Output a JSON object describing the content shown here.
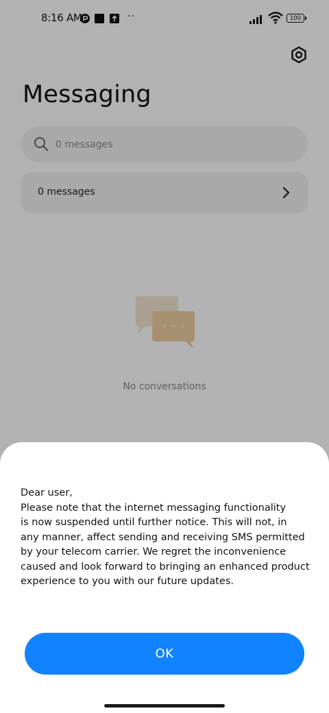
{
  "status_bar": {
    "time": "8:16 AM",
    "icons": [
      "app-notification-icon",
      "square-notification-icon",
      "upload-notification-icon",
      "more-notifications-icon",
      "signal-icon",
      "wifi-icon",
      "battery-icon"
    ],
    "more_dots": "··",
    "battery_level": "100"
  },
  "header": {
    "title": "Messaging",
    "settings_icon": "settings-icon"
  },
  "search": {
    "placeholder": "0 messages",
    "icon": "search-icon"
  },
  "messages_row": {
    "label": "0 messages",
    "icon": "chevron-right-icon"
  },
  "empty_state": {
    "icon": "chat-bubbles-icon",
    "text": "No conversations"
  },
  "dialog": {
    "body": "Dear user,\nPlease note that the internet messaging functionality\nis now suspended until further notice. This will not, in\nany manner, affect sending and receiving SMS permitted\nby your telecom carrier. We regret the inconvenience\ncaused and look forward to bringing an enhanced product\nexperience to you with our future updates.",
    "ok_label": "OK"
  },
  "colors": {
    "accent": "#1183ff",
    "scrim": "rgba(0,0,0,0.30)",
    "bubble_back": "#f3e6d2",
    "bubble_front": "#efcf9f"
  }
}
